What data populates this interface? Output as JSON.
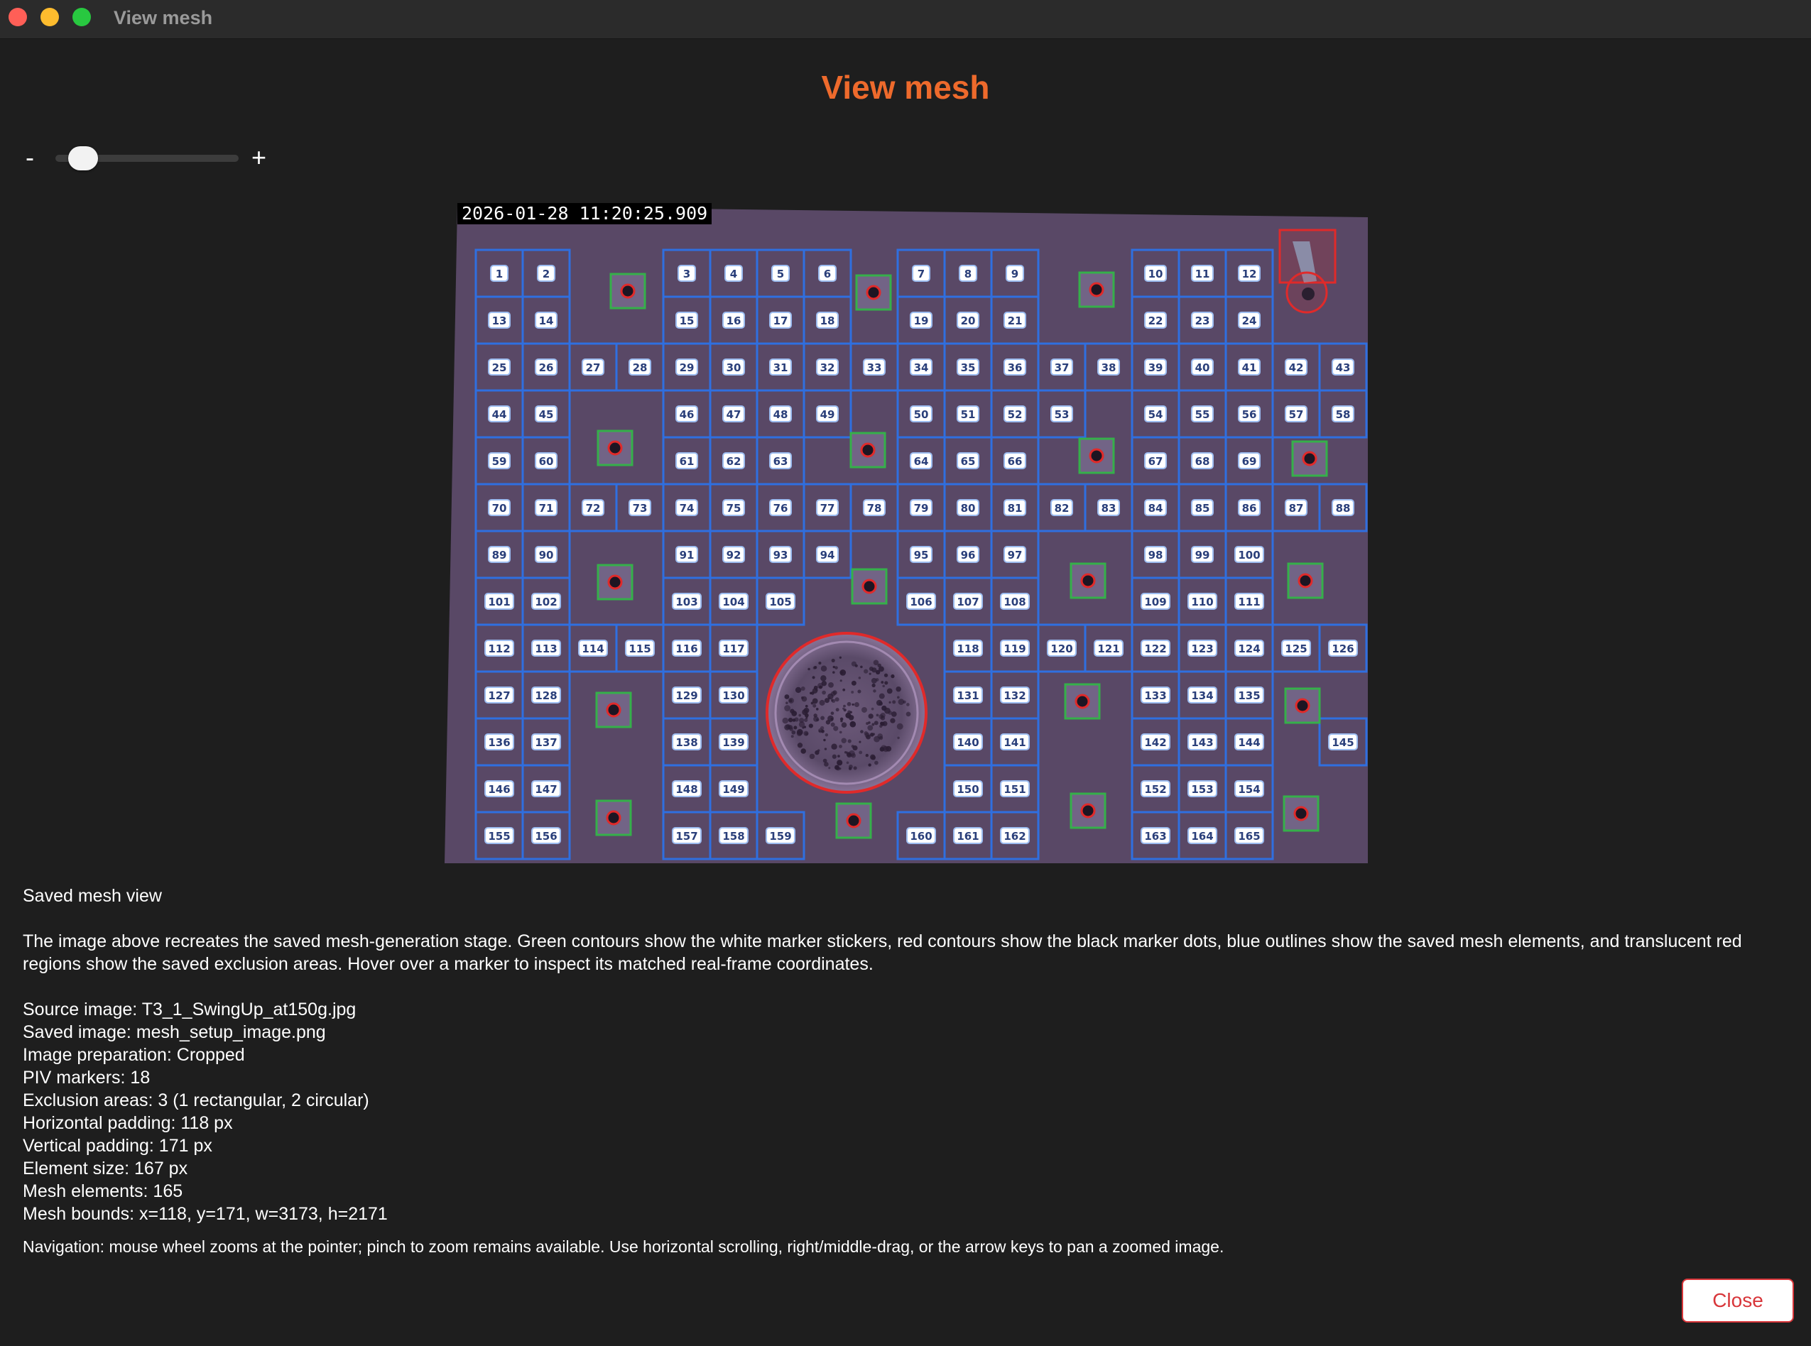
{
  "window": {
    "title": "View mesh"
  },
  "page": {
    "title": "View mesh"
  },
  "zoom": {
    "minus_label": "-",
    "plus_label": "+",
    "level": 0.1
  },
  "image": {
    "timestamp": "2026-01-28 11:20:25.909",
    "mesh_labels": [
      "1",
      "2",
      "3",
      "4",
      "5",
      "6",
      "7",
      "8",
      "9",
      "10",
      "11",
      "12",
      "13",
      "14",
      "15",
      "16",
      "17",
      "18",
      "19",
      "20",
      "21",
      "22",
      "23",
      "24",
      "25",
      "26",
      "27",
      "28",
      "29",
      "30",
      "31",
      "32",
      "33",
      "34",
      "35",
      "36",
      "37",
      "38",
      "39",
      "40",
      "41",
      "42",
      "43",
      "44",
      "45",
      "46",
      "47",
      "48",
      "49",
      "50",
      "51",
      "52",
      "53",
      "54",
      "55",
      "56",
      "57",
      "58",
      "59",
      "60",
      "61",
      "62",
      "63",
      "64",
      "65",
      "66",
      "67",
      "68",
      "69",
      "70",
      "71",
      "72",
      "73",
      "74",
      "75",
      "76",
      "77",
      "78",
      "79",
      "80",
      "81",
      "82",
      "83",
      "84",
      "85",
      "86",
      "87",
      "88",
      "89",
      "90",
      "91",
      "92",
      "93",
      "94",
      "95",
      "96",
      "97",
      "98",
      "99",
      "100",
      "101",
      "102",
      "103",
      "104",
      "105",
      "106",
      "107",
      "108",
      "109",
      "110",
      "111",
      "112",
      "113",
      "114",
      "115",
      "116",
      "117",
      "118",
      "119",
      "120",
      "121",
      "122",
      "123",
      "124",
      "125",
      "126",
      "127",
      "128",
      "129",
      "130",
      "131",
      "132",
      "133",
      "134",
      "135",
      "136",
      "137",
      "138",
      "139",
      "140",
      "141",
      "142",
      "143",
      "144",
      "145",
      "146",
      "147",
      "148",
      "149",
      "150",
      "151",
      "152",
      "153",
      "154",
      "155",
      "156",
      "157",
      "158",
      "159",
      "160",
      "161",
      "162",
      "163",
      "164",
      "165"
    ],
    "colors": {
      "mesh": "#2f6fe0",
      "marker_sticker": "#35b04a",
      "marker_dot": "#e02a2a",
      "exclusion": "#e02a2a",
      "background": "#5c4a66"
    }
  },
  "info": {
    "heading": "Saved mesh view",
    "description": "The image above recreates the saved mesh-generation stage. Green contours show the white marker stickers, red contours show the black marker dots, blue outlines show the saved mesh elements, and translucent red regions show the saved exclusion areas. Hover over a marker to inspect its matched real-frame coordinates.",
    "details": [
      "Source image: T3_1_SwingUp_at150g.jpg",
      "Saved image: mesh_setup_image.png",
      "Image preparation: Cropped",
      "PIV markers: 18",
      "Exclusion areas: 3 (1 rectangular, 2 circular)",
      "Horizontal padding: 118 px",
      "Vertical padding: 171 px",
      "Element size: 167 px",
      "Mesh elements: 165",
      "Mesh bounds: x=118, y=171, w=3173, h=2171"
    ],
    "navigation": "Navigation: mouse wheel zooms at the pointer; pinch to zoom remains available. Use horizontal scrolling, right/middle-drag, or the arrow keys to pan a zoomed image."
  },
  "buttons": {
    "close_label": "Close"
  }
}
